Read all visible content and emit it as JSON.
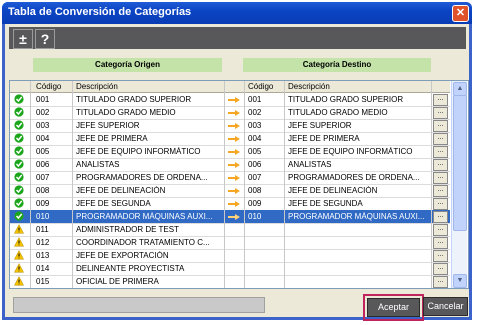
{
  "window": {
    "title": "Tabla de Conversión de Categorías",
    "close_label": "✕"
  },
  "toolbar": {
    "add_label": "±",
    "help_label": "?"
  },
  "headers": {
    "origin": "Categoría Origen",
    "dest": "Categoría Destino"
  },
  "columns": {
    "code": "Código",
    "desc": "Descripción",
    "code2": "Código",
    "desc2": "Descripción"
  },
  "rows": [
    {
      "status": "ok",
      "code": "001",
      "desc": "TITULADO GRADO SUPERIOR",
      "dcode": "001",
      "ddesc": "TITULADO GRADO SUPERIOR",
      "btn": "..."
    },
    {
      "status": "ok",
      "code": "002",
      "desc": "TITULADO GRADO MEDIO",
      "dcode": "002",
      "ddesc": "TITULADO GRADO MEDIO",
      "btn": "..."
    },
    {
      "status": "ok",
      "code": "003",
      "desc": "JEFE SUPERIOR",
      "dcode": "003",
      "ddesc": "JEFE SUPERIOR",
      "btn": "..."
    },
    {
      "status": "ok",
      "code": "004",
      "desc": "JEFE DE PRIMERA",
      "dcode": "004",
      "ddesc": "JEFE DE PRIMERA",
      "btn": "..."
    },
    {
      "status": "ok",
      "code": "005",
      "desc": "JEFE DE EQUIPO INFORMÁTICO",
      "dcode": "005",
      "ddesc": "JEFE DE EQUIPO INFORMÁTICO",
      "btn": "..."
    },
    {
      "status": "ok",
      "code": "006",
      "desc": "ANALISTAS",
      "dcode": "006",
      "ddesc": "ANALISTAS",
      "btn": "..."
    },
    {
      "status": "ok",
      "code": "007",
      "desc": "PROGRAMADORES DE ORDENA...",
      "dcode": "007",
      "ddesc": "PROGRAMADORES DE ORDENA...",
      "btn": "..."
    },
    {
      "status": "ok",
      "code": "008",
      "desc": "JEFE DE DELINEACIÓN",
      "dcode": "008",
      "ddesc": "JEFE DE DELINEACIÓN",
      "btn": "..."
    },
    {
      "status": "ok",
      "code": "009",
      "desc": "JEFE DE SEGUNDA",
      "dcode": "009",
      "ddesc": "JEFE DE SEGUNDA",
      "btn": "..."
    },
    {
      "status": "ok",
      "code": "010",
      "desc": "PROGRAMADOR MÁQUINAS AUXI...",
      "dcode": "010",
      "ddesc": "PROGRAMADOR MÁQUINAS AUXI...",
      "btn": "...",
      "selected": true
    },
    {
      "status": "warn",
      "code": "011",
      "desc": "ADMINISTRADOR DE TEST",
      "dcode": "",
      "ddesc": "",
      "btn": "..."
    },
    {
      "status": "warn",
      "code": "012",
      "desc": "COORDINADOR TRATAMIENTO C...",
      "dcode": "",
      "ddesc": "",
      "btn": "..."
    },
    {
      "status": "warn",
      "code": "013",
      "desc": "JEFE DE EXPORTACIÓN",
      "dcode": "",
      "ddesc": "",
      "btn": "..."
    },
    {
      "status": "warn",
      "code": "014",
      "desc": "DELINEANTE PROYECTISTA",
      "dcode": "",
      "ddesc": "",
      "btn": "..."
    },
    {
      "status": "warn",
      "code": "015",
      "desc": "OFICIAL DE PRIMERA",
      "dcode": "",
      "ddesc": "",
      "btn": "..."
    }
  ],
  "buttons": {
    "accept": "Aceptar",
    "cancel": "Cancelar"
  },
  "colors": {
    "ok": "#1aa51a",
    "warn": "#f3c300",
    "selected": "#316ac5",
    "header_green": "#c4e3a8"
  }
}
